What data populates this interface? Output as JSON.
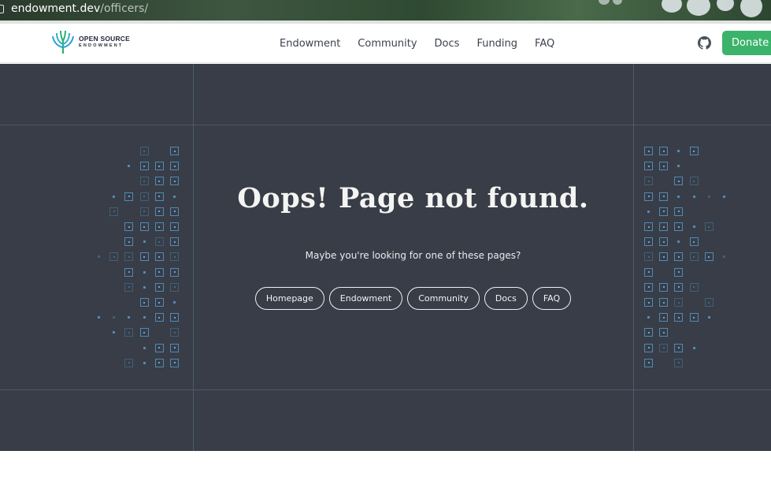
{
  "browser": {
    "url_host": "endowment.dev",
    "url_path": "/officers/"
  },
  "nav": {
    "logo_line1": "OPEN SOURCE",
    "logo_line2": "ENDOWMENT",
    "items": [
      "Endowment",
      "Community",
      "Docs",
      "Funding",
      "FAQ"
    ],
    "github_icon": "github-icon",
    "donate_label": "Donate"
  },
  "main": {
    "title": "Oops! Page not found.",
    "subtitle": "Maybe you're looking for one of these pages?",
    "links": [
      "Homepage",
      "Endowment",
      "Community",
      "Docs",
      "FAQ"
    ]
  },
  "colors": {
    "background": "#383d47",
    "accent": "#3bb36b",
    "grid_line": "#4e5a6e",
    "pattern": "#4f8ab8"
  }
}
